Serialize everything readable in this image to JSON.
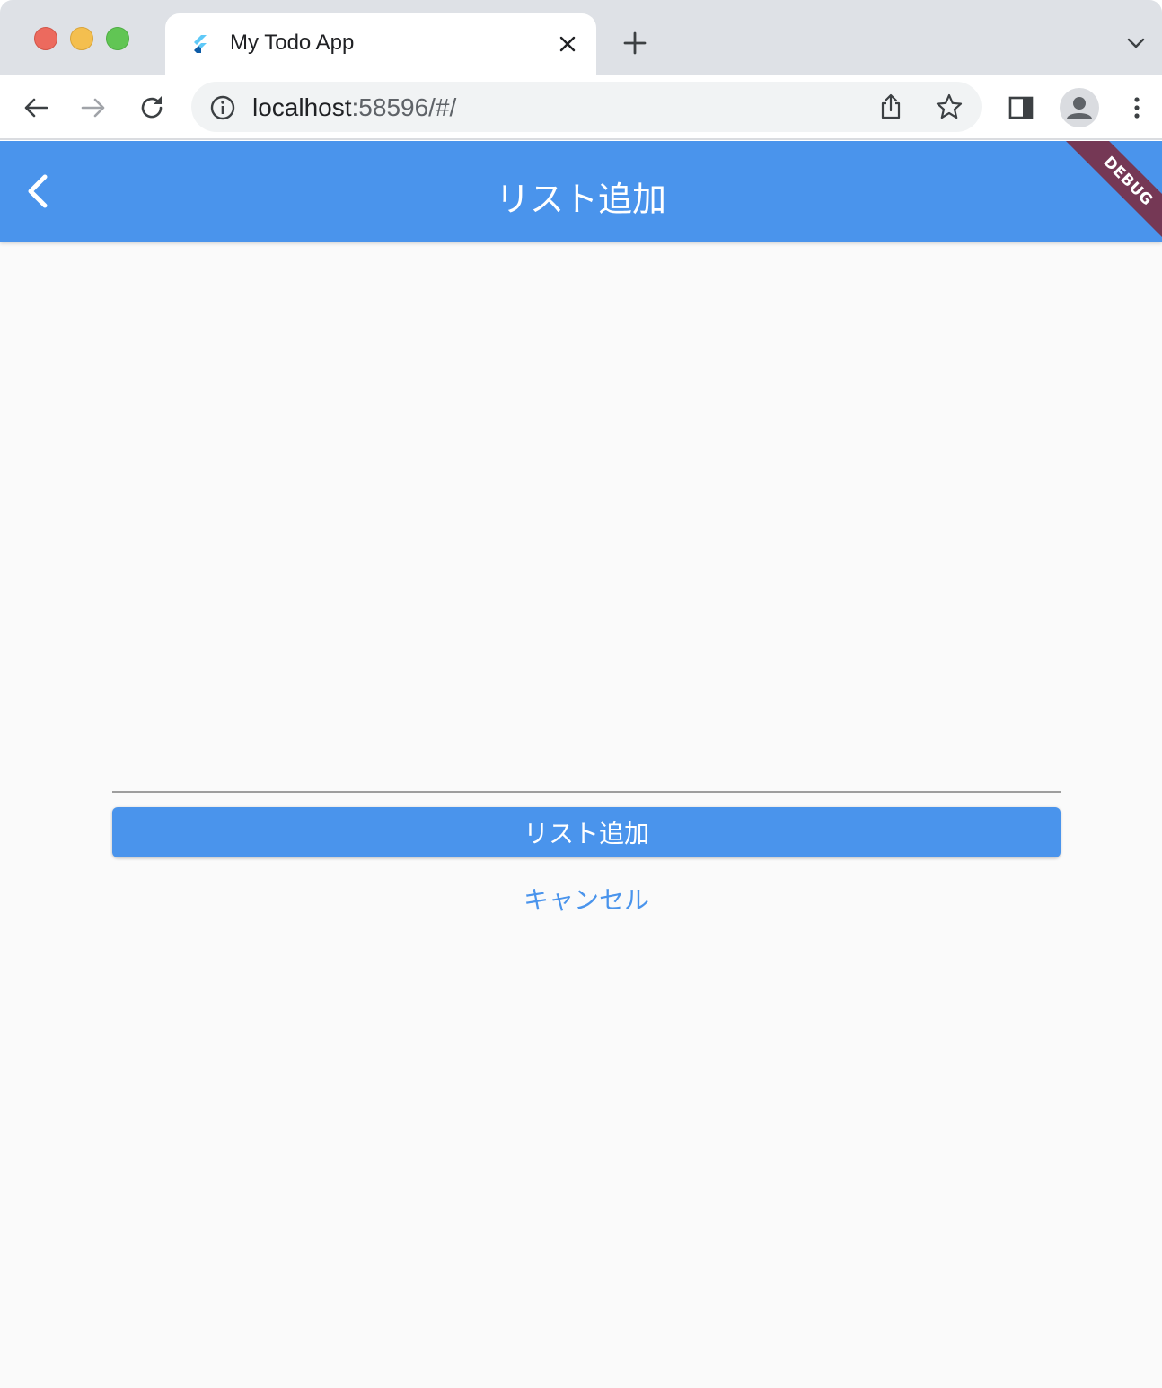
{
  "browser": {
    "tab_title": "My Todo App",
    "url_host": "localhost",
    "url_rest": ":58596/#/"
  },
  "app": {
    "appbar_title": "リスト追加",
    "debug_banner": "DEBUG",
    "text_field_value": "",
    "add_button_label": "リスト追加",
    "cancel_button_label": "キャンセル"
  },
  "colors": {
    "primary": "#4a94ec",
    "background": "#fafafa",
    "debug_banner": "#802030"
  },
  "icons": {
    "back": "chevron-left-icon",
    "reload": "reload-icon",
    "info": "info-icon",
    "share": "share-icon",
    "bookmark": "star-icon",
    "side_panel": "side-panel-icon",
    "profile": "avatar-icon",
    "menu": "kebab-menu-icon"
  }
}
